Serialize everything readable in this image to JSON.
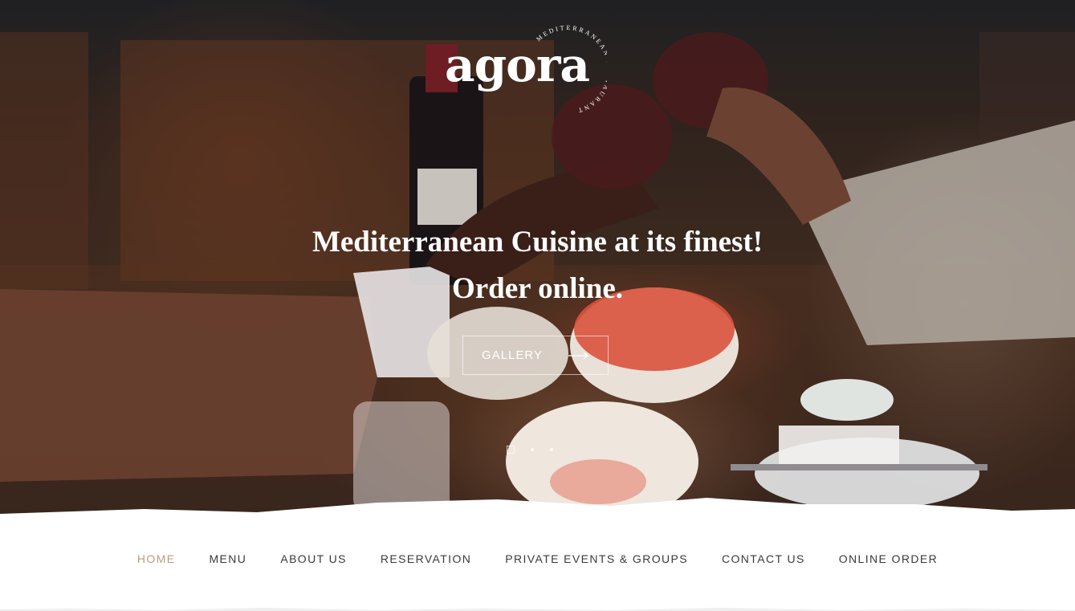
{
  "brand": {
    "logo_text": "agora",
    "logo_ring_text": "MEDITERRANEAN RESTAURANT"
  },
  "hero": {
    "headline_line1": "Mediterranean Cuisine at its finest!",
    "headline_line2": "Order online.",
    "cta_label": "GALLERY",
    "slides_count": 3,
    "active_slide": 1
  },
  "nav": {
    "items": [
      {
        "label": "HOME",
        "active": true
      },
      {
        "label": "MENU",
        "active": false
      },
      {
        "label": "ABOUT US",
        "active": false
      },
      {
        "label": "RESERVATION",
        "active": false
      },
      {
        "label": "PRIVATE EVENTS & GROUPS",
        "active": false
      },
      {
        "label": "CONTACT US",
        "active": false
      },
      {
        "label": "ONLINE ORDER",
        "active": false
      }
    ]
  },
  "colors": {
    "accent": "#b99b7f",
    "nav_text": "#3a3a3a",
    "background": "#ffffff"
  }
}
